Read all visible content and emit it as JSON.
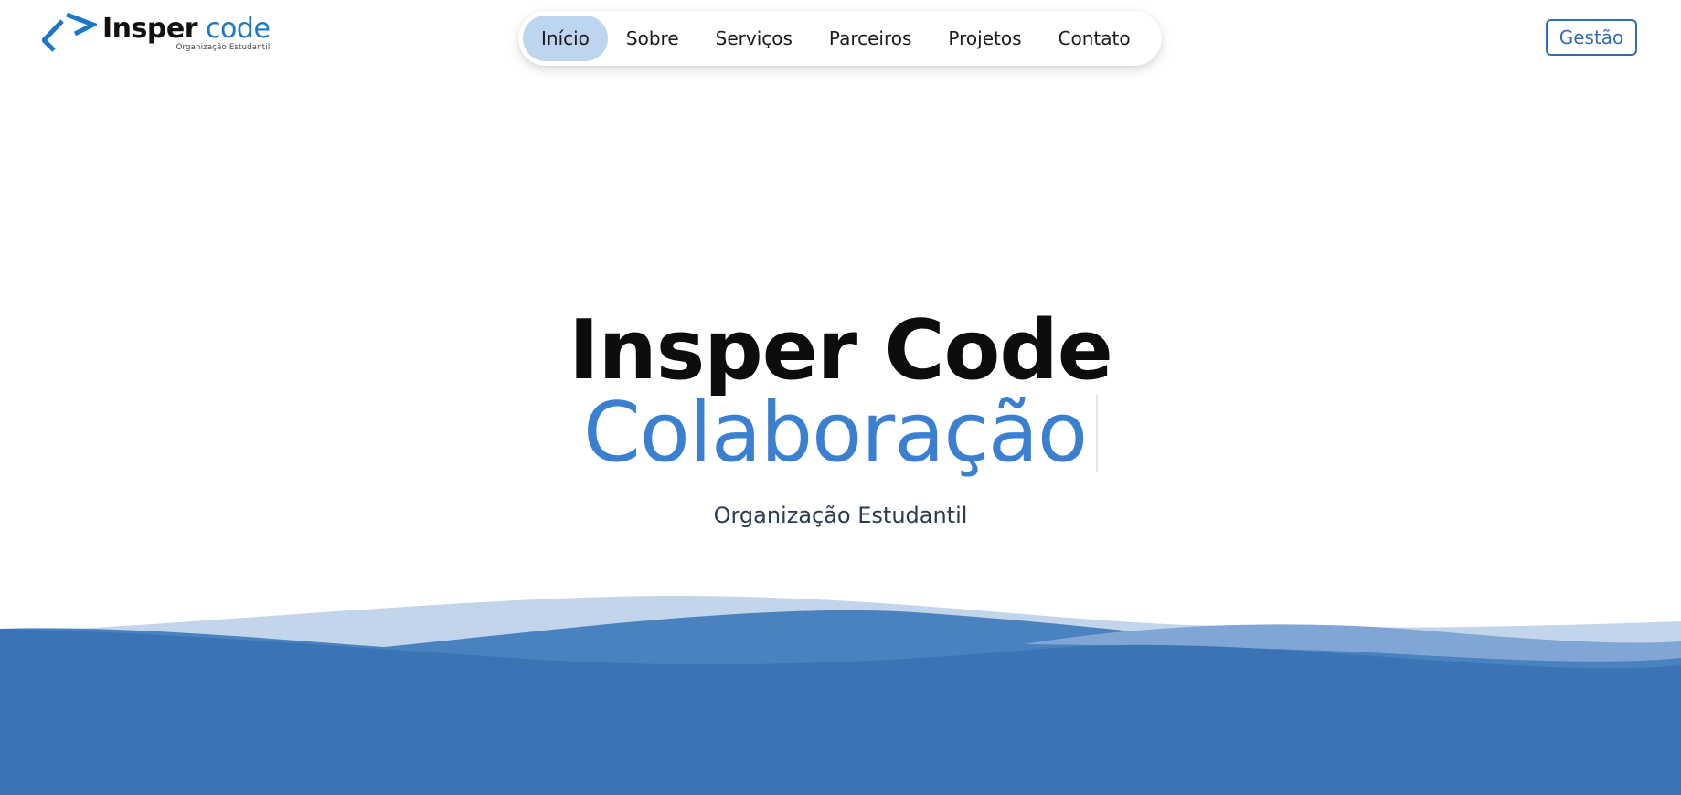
{
  "logo": {
    "word1": "Insper",
    "word2": "code",
    "tagline": "Organização Estudantil"
  },
  "nav": {
    "items": [
      {
        "label": "Início",
        "active": true
      },
      {
        "label": "Sobre",
        "active": false
      },
      {
        "label": "Serviços",
        "active": false
      },
      {
        "label": "Parceiros",
        "active": false
      },
      {
        "label": "Projetos",
        "active": false
      },
      {
        "label": "Contato",
        "active": false
      }
    ]
  },
  "header": {
    "gestao_label": "Gestão"
  },
  "hero": {
    "title": "Insper Code",
    "rotating_word": "Colaboração",
    "subtitle": "Organização Estudantil"
  },
  "colors": {
    "brand_blue": "#1b78c9",
    "hero_accent": "#3a7fd0",
    "nav_active_bg": "#bed5f0",
    "gestao_border": "#2f6db3",
    "wave_light": "#c3d5ea",
    "wave_mid": "#4a82c0",
    "wave_dark": "#3a74b5"
  }
}
